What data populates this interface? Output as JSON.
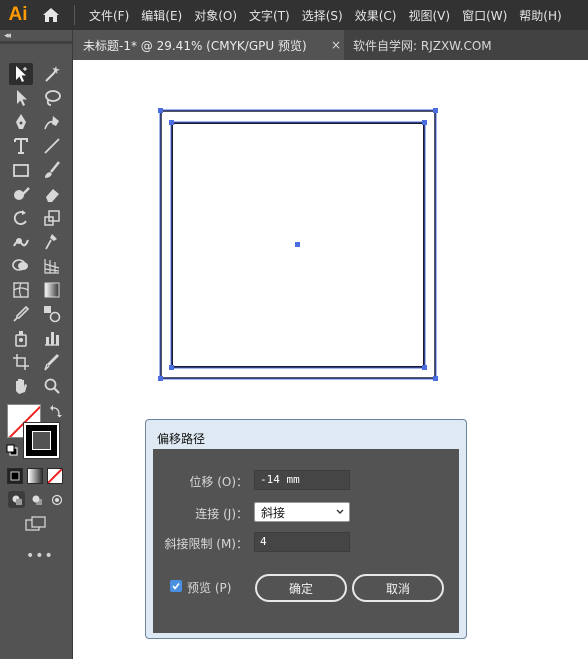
{
  "app": {
    "logo": "Ai"
  },
  "menu": [
    "文件(F)",
    "编辑(E)",
    "对象(O)",
    "文字(T)",
    "选择(S)",
    "效果(C)",
    "视图(V)",
    "窗口(W)",
    "帮助(H)"
  ],
  "tabs": {
    "document": "未标题-1* @ 29.41% (CMYK/GPU 预览)",
    "close": "×",
    "site": "软件自学网: RJZXW.COM"
  },
  "toolbar": {
    "collapse": "◂◂",
    "more": "•••"
  },
  "dialog": {
    "title": "偏移路径",
    "offset_label": "位移 (O)：",
    "offset_value": "-14 mm",
    "join_label": "连接 (J)：",
    "join_value": "斜接",
    "miter_label": "斜接限制 (M)：",
    "miter_value": "4",
    "preview_label": "预览 (P)",
    "preview_checked": true,
    "ok_label": "确定",
    "cancel_label": "取消"
  },
  "colors": {
    "accent": "#ff9a00",
    "selection": "#4a6ee0",
    "checkbox": "#4a90e2"
  }
}
